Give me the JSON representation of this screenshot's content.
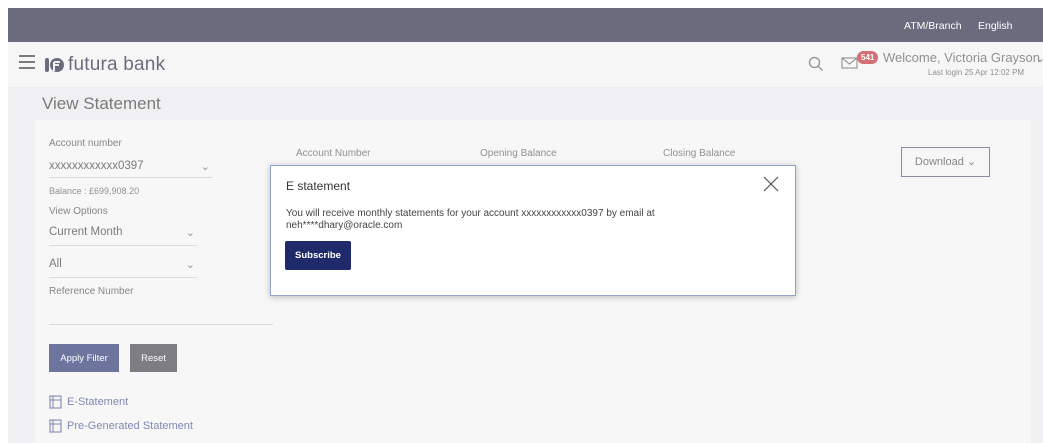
{
  "topbar": {
    "atm_branch": "ATM/Branch",
    "language": "English"
  },
  "header": {
    "brand": "futura bank",
    "notification_count": "541",
    "welcome": "Welcome, Victoria Grayson",
    "last_login": "Last login 25 Apr 12:02 PM"
  },
  "page": {
    "title": "View Statement"
  },
  "filters": {
    "account_number_label": "Account number",
    "account_number_value": "xxxxxxxxxxxx0397",
    "balance": "Balance : £699,908.20",
    "view_options_label": "View Options",
    "view_option_value": "Current Month",
    "type_value": "All",
    "reference_number_label": "Reference Number",
    "apply_label": "Apply Filter",
    "reset_label": "Reset"
  },
  "links": {
    "estatement": "E-Statement",
    "pregenerated": "Pre-Generated Statement"
  },
  "summary": {
    "account_number": "Account Number",
    "opening_balance": "Opening Balance",
    "closing_balance": "Closing Balance",
    "download_label": "Download"
  },
  "modal": {
    "title": "E statement",
    "message": "You will receive monthly statements for your account xxxxxxxxxxxx0397 by email at neh****dhary@oracle.com",
    "subscribe_label": "Subscribe"
  },
  "colors": {
    "topbar": "#1c1d39",
    "primary_button": "#1f2a6b",
    "badge": "#c0212b"
  },
  "icons": [
    "menu-icon",
    "bank-logo-icon",
    "search-icon",
    "mail-icon",
    "chevron-down-icon",
    "close-icon",
    "document-icon"
  ]
}
